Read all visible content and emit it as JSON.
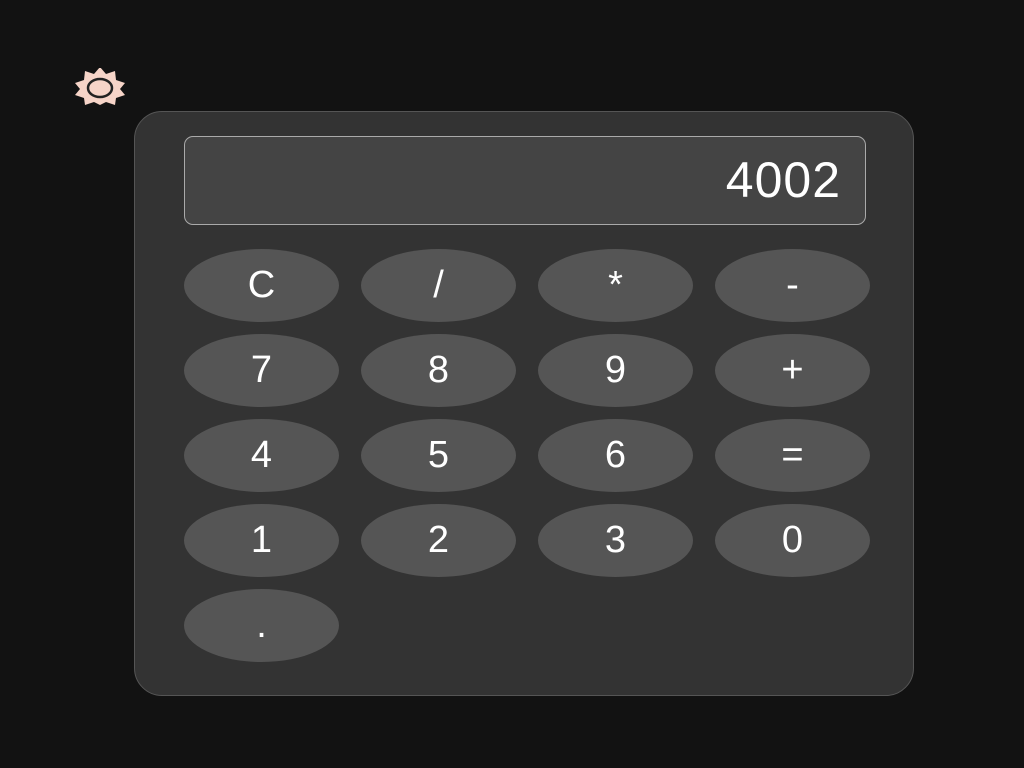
{
  "theme_toggle": {
    "icon": "sun-icon",
    "color": "#f6d4c8"
  },
  "display": {
    "value": "4002"
  },
  "keys": [
    {
      "label": "C",
      "name": "clear-button"
    },
    {
      "label": "/",
      "name": "divide-button"
    },
    {
      "label": "*",
      "name": "multiply-button"
    },
    {
      "label": "-",
      "name": "subtract-button"
    },
    {
      "label": "7",
      "name": "digit-7-button"
    },
    {
      "label": "8",
      "name": "digit-8-button"
    },
    {
      "label": "9",
      "name": "digit-9-button"
    },
    {
      "label": "+",
      "name": "add-button"
    },
    {
      "label": "4",
      "name": "digit-4-button"
    },
    {
      "label": "5",
      "name": "digit-5-button"
    },
    {
      "label": "6",
      "name": "digit-6-button"
    },
    {
      "label": "=",
      "name": "equals-button"
    },
    {
      "label": "1",
      "name": "digit-1-button"
    },
    {
      "label": "2",
      "name": "digit-2-button"
    },
    {
      "label": "3",
      "name": "digit-3-button"
    },
    {
      "label": "0",
      "name": "digit-0-button"
    },
    {
      "label": ".",
      "name": "decimal-button"
    }
  ],
  "colors": {
    "page_background": "#121212",
    "calculator_body": "#333333",
    "display_background": "#444444",
    "key_background": "#555555",
    "text": "#ffffff"
  }
}
